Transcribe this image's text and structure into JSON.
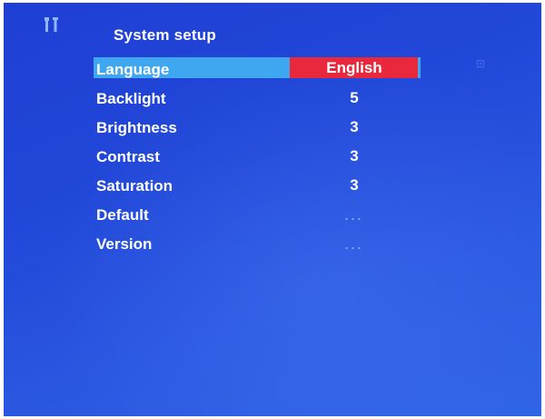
{
  "header": {
    "title": "System setup",
    "icon": "setup-tools-icon"
  },
  "menu": {
    "items": [
      {
        "label": "Language",
        "value": "English",
        "selected": true
      },
      {
        "label": "Backlight",
        "value": "5"
      },
      {
        "label": "Brightness",
        "value": "3"
      },
      {
        "label": "Contrast",
        "value": "3"
      },
      {
        "label": "Saturation",
        "value": "3"
      },
      {
        "label": "Default",
        "value": "..."
      },
      {
        "label": "Version",
        "value": "..."
      }
    ]
  },
  "colors": {
    "background": "#2147d8",
    "highlight_row": "#3fa7f0",
    "highlight_value": "#e9273d",
    "text": "#ffffff"
  }
}
